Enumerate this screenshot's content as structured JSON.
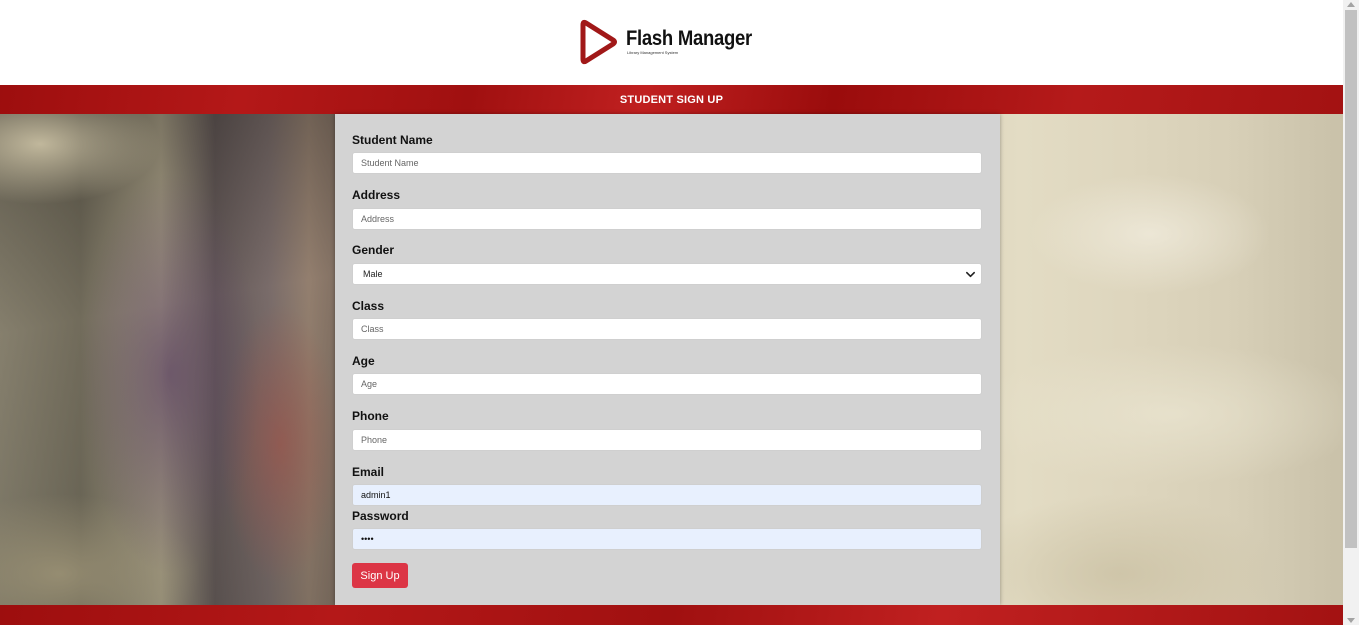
{
  "brand": {
    "name": "Flash Manager",
    "tagline": "Library Management System",
    "logo_icon": "play-triangle-icon",
    "accent_color": "#b01515"
  },
  "page_title": "STUDENT SIGN UP",
  "form": {
    "student_name": {
      "label": "Student Name",
      "placeholder": "Student Name",
      "value": ""
    },
    "address": {
      "label": "Address",
      "placeholder": "Address",
      "value": ""
    },
    "gender": {
      "label": "Gender",
      "selected": "Male"
    },
    "class": {
      "label": "Class",
      "placeholder": "Class",
      "value": ""
    },
    "age": {
      "label": "Age",
      "placeholder": "Age",
      "value": ""
    },
    "phone": {
      "label": "Phone",
      "placeholder": "Phone",
      "value": ""
    },
    "email": {
      "label": "Email",
      "value": "admin1"
    },
    "password": {
      "label": "Password",
      "value": "1234"
    },
    "submit_label": "Sign Up",
    "submit_color": "#dc3545"
  }
}
